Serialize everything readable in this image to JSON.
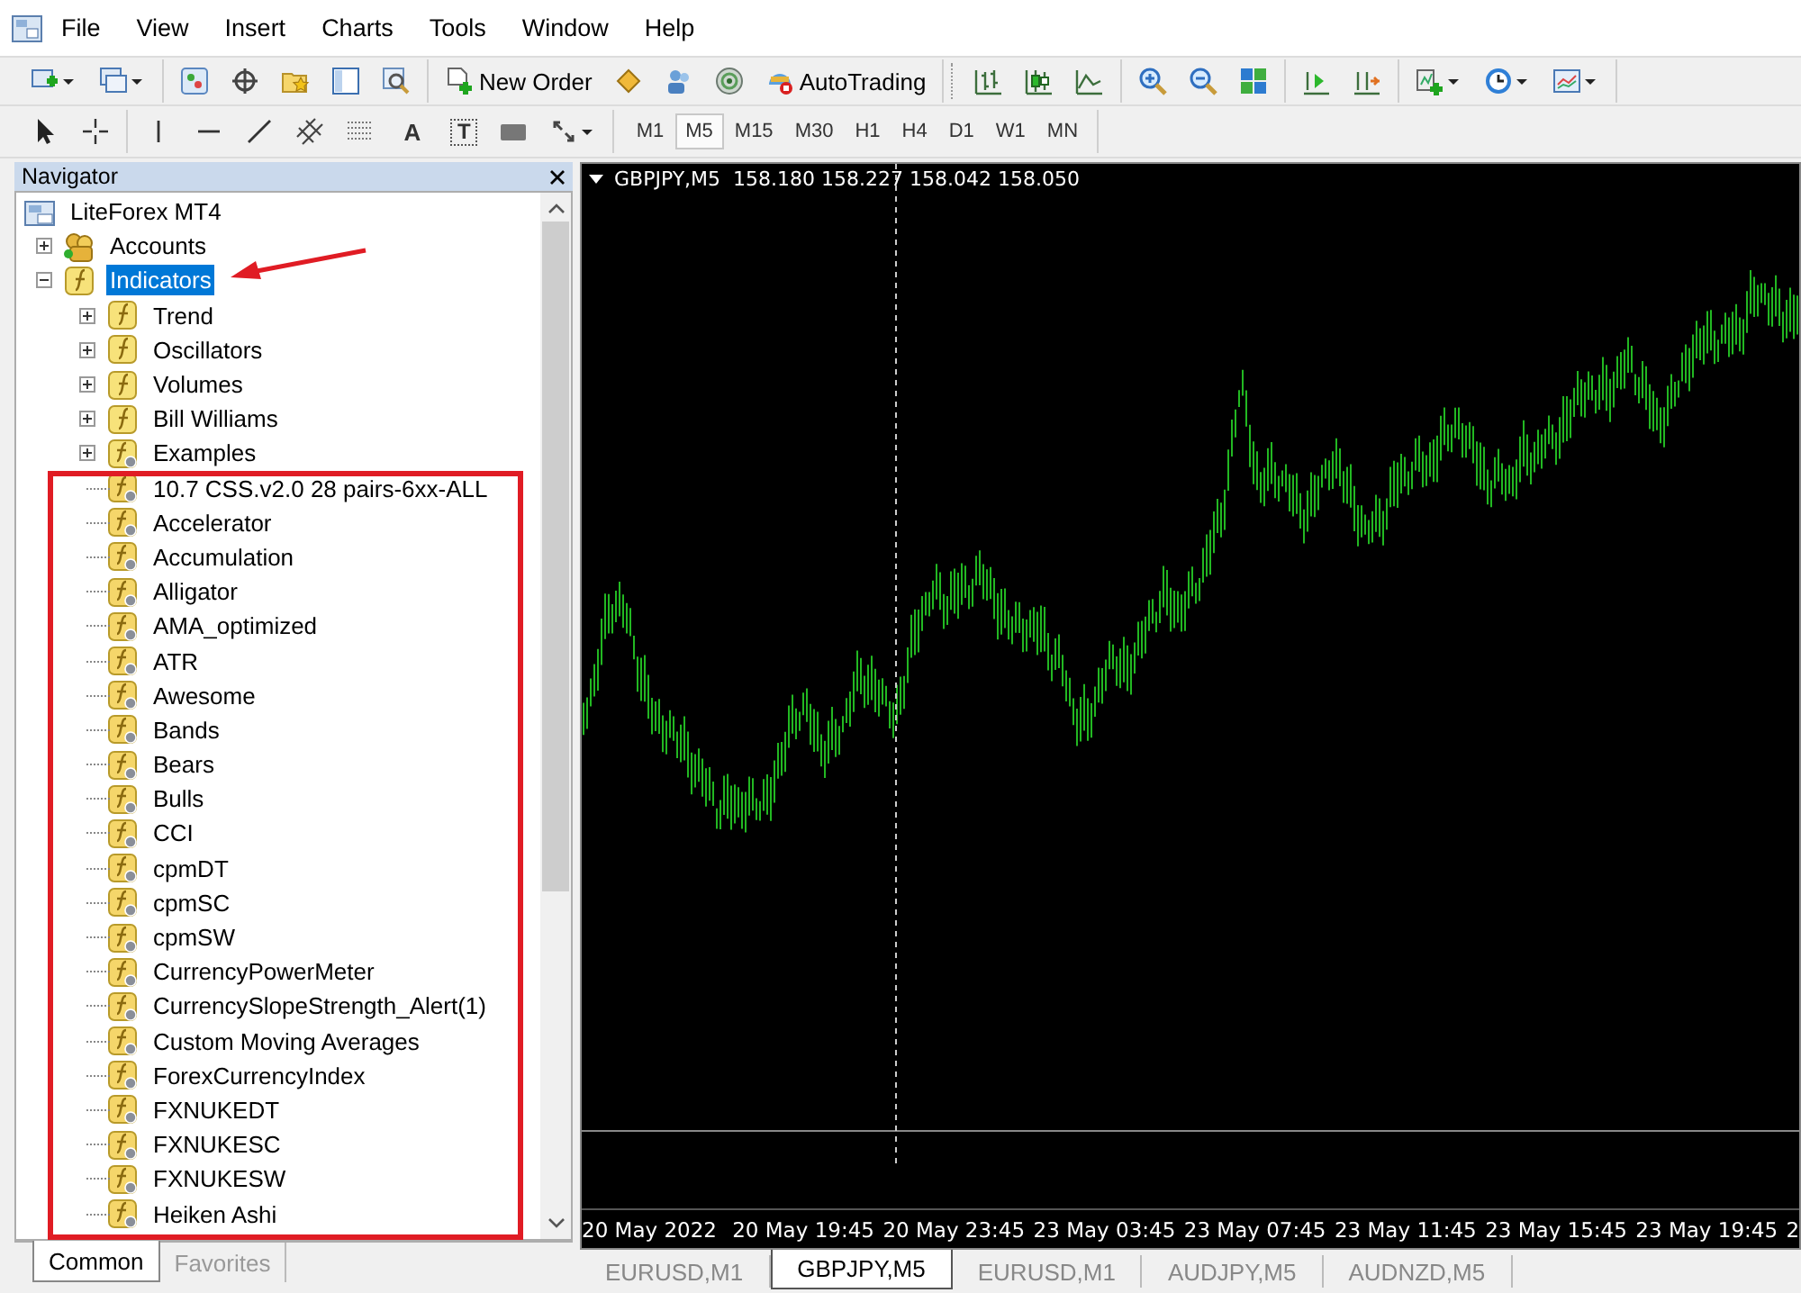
{
  "menu": [
    {
      "label": "File"
    },
    {
      "label": "View"
    },
    {
      "label": "Insert"
    },
    {
      "label": "Charts"
    },
    {
      "label": "Tools"
    },
    {
      "label": "Window"
    },
    {
      "label": "Help"
    }
  ],
  "toolbar": {
    "new_order": "New Order",
    "auto_trading": "AutoTrading"
  },
  "drawing_tools": {
    "text_tool": "A",
    "label_tool": "T"
  },
  "timeframes": [
    {
      "label": "M1",
      "selected": false
    },
    {
      "label": "M5",
      "selected": true
    },
    {
      "label": "M15",
      "selected": false
    },
    {
      "label": "M30",
      "selected": false
    },
    {
      "label": "H1",
      "selected": false
    },
    {
      "label": "H4",
      "selected": false
    },
    {
      "label": "D1",
      "selected": false
    },
    {
      "label": "W1",
      "selected": false
    },
    {
      "label": "MN",
      "selected": false
    }
  ],
  "navigator": {
    "title": "Navigator",
    "tree": [
      {
        "label": "LiteForex MT4",
        "kind": "terminal",
        "selected": false,
        "children": [
          {
            "label": "Accounts",
            "kind": "accounts",
            "expanded": false,
            "selected": false
          },
          {
            "label": "Indicators",
            "kind": "folder",
            "expanded": true,
            "selected": true,
            "children": [
              {
                "label": "Trend",
                "kind": "folder",
                "expanded": false,
                "selected": false
              },
              {
                "label": "Oscillators",
                "kind": "folder",
                "expanded": false,
                "selected": false
              },
              {
                "label": "Volumes",
                "kind": "folder",
                "expanded": false,
                "selected": false
              },
              {
                "label": "Bill Williams",
                "kind": "folder",
                "expanded": false,
                "selected": false
              },
              {
                "label": "Examples",
                "kind": "custom-folder",
                "expanded": false,
                "selected": false
              },
              {
                "label": "10.7 CSS.v2.0 28 pairs-6xx-ALL",
                "kind": "indicator",
                "selected": false
              },
              {
                "label": "Accelerator",
                "kind": "indicator",
                "selected": false
              },
              {
                "label": "Accumulation",
                "kind": "indicator",
                "selected": false
              },
              {
                "label": "Alligator",
                "kind": "indicator",
                "selected": false
              },
              {
                "label": "AMA_optimized",
                "kind": "indicator",
                "selected": false
              },
              {
                "label": "ATR",
                "kind": "indicator",
                "selected": false
              },
              {
                "label": "Awesome",
                "kind": "indicator",
                "selected": false
              },
              {
                "label": "Bands",
                "kind": "indicator",
                "selected": false
              },
              {
                "label": "Bears",
                "kind": "indicator",
                "selected": false
              },
              {
                "label": "Bulls",
                "kind": "indicator",
                "selected": false
              },
              {
                "label": "CCI",
                "kind": "indicator",
                "selected": false
              },
              {
                "label": "cpmDT",
                "kind": "indicator",
                "selected": false
              },
              {
                "label": "cpmSC",
                "kind": "indicator",
                "selected": false
              },
              {
                "label": "cpmSW",
                "kind": "indicator",
                "selected": false
              },
              {
                "label": "CurrencyPowerMeter",
                "kind": "indicator",
                "selected": false
              },
              {
                "label": "CurrencySlopeStrength_Alert(1)",
                "kind": "indicator",
                "selected": false
              },
              {
                "label": "Custom Moving Averages",
                "kind": "indicator",
                "selected": false
              },
              {
                "label": "ForexCurrencyIndex",
                "kind": "indicator",
                "selected": false
              },
              {
                "label": "FXNUKEDT",
                "kind": "indicator",
                "selected": false
              },
              {
                "label": "FXNUKESC",
                "kind": "indicator",
                "selected": false
              },
              {
                "label": "FXNUKESW",
                "kind": "indicator",
                "selected": false
              },
              {
                "label": "Heiken Ashi",
                "kind": "indicator",
                "selected": false
              }
            ]
          }
        ]
      }
    ],
    "tabs": [
      {
        "label": "Common",
        "selected": true
      },
      {
        "label": "Favorites",
        "selected": false
      }
    ]
  },
  "chart": {
    "header": "GBPJPY,M5  158.180 158.227 158.042 158.050",
    "time_labels": [
      "20 May 2022",
      "20 May 19:45",
      "20 May 23:45",
      "23 May 03:45",
      "23 May 07:45",
      "23 May 11:45",
      "23 May 15:45",
      "23 May 19:45",
      "2"
    ]
  },
  "chart_tabs": [
    {
      "label": "EURUSD,M1",
      "selected": false
    },
    {
      "label": "GBPJPY,M5",
      "selected": true
    },
    {
      "label": "EURUSD,M1",
      "selected": false
    },
    {
      "label": "AUDJPY,M5",
      "selected": false
    },
    {
      "label": "AUDNZD,M5",
      "selected": false
    }
  ]
}
